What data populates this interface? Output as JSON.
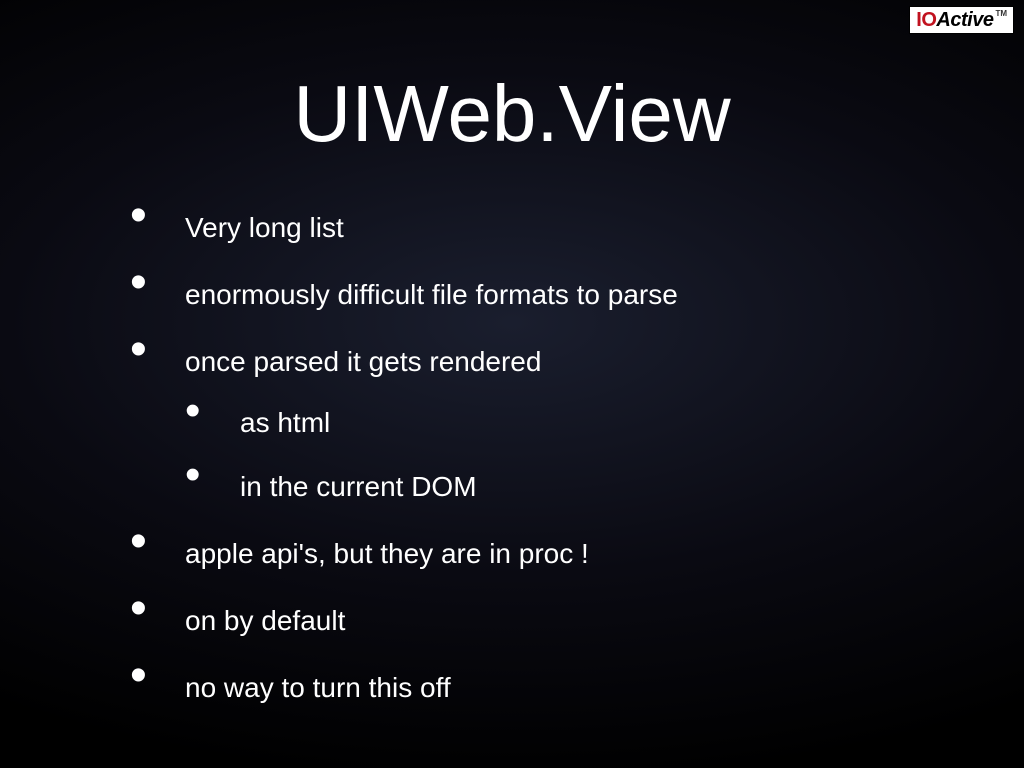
{
  "logo": {
    "part1": "IO",
    "part2": "Active",
    "tm": "TM"
  },
  "title": "UIWeb.View",
  "bullets": {
    "b1": "Very long list",
    "b2": "enormously difficult file formats to parse",
    "b3": "once parsed it gets rendered",
    "b3_sub1": "as html",
    "b3_sub2": "in the current DOM",
    "b4": "apple api's, but they are in proc !",
    "b5": "on by default",
    "b6": "no way to turn this off"
  }
}
